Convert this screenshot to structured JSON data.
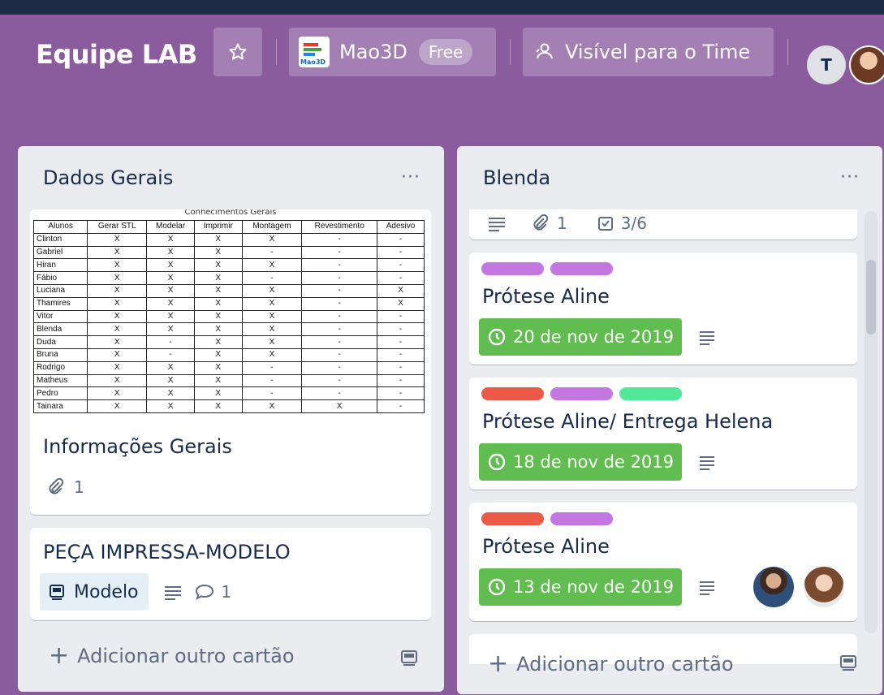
{
  "board": {
    "title": "Equipe LAB",
    "org_name": "Mao3D",
    "org_logo_text": "Mao3D",
    "org_plan": "Free",
    "visibility": "Visível para o Time",
    "member_initial": "T"
  },
  "lists": [
    {
      "title": "Dados Gerais",
      "menu": "···",
      "cards": [
        {
          "title": "Informações Gerais",
          "attachments": "1",
          "cover_table": {
            "caption": "Conhecimentos Gerais",
            "headers": [
              "Alunos",
              "Gerar STL",
              "Modelar",
              "Imprimir",
              "Montagem",
              "Revestimento",
              "Adesivo"
            ],
            "rows": [
              [
                "Clinton",
                "X",
                "X",
                "X",
                "X",
                "-",
                "-"
              ],
              [
                "Gabriel",
                "X",
                "X",
                "X",
                "-",
                "-",
                "-"
              ],
              [
                "Hiran",
                "X",
                "X",
                "X",
                "X",
                "-",
                "-"
              ],
              [
                "Fábio",
                "X",
                "X",
                "X",
                "-",
                "-",
                "-"
              ],
              [
                "Luciana",
                "X",
                "X",
                "X",
                "X",
                "-",
                "X"
              ],
              [
                "Thamires",
                "X",
                "X",
                "X",
                "X",
                "-",
                "X"
              ],
              [
                "Vitor",
                "X",
                "X",
                "X",
                "X",
                "-",
                "-"
              ],
              [
                "Blenda",
                "X",
                "X",
                "X",
                "X",
                "-",
                "-"
              ],
              [
                "Duda",
                "X",
                "-",
                "X",
                "X",
                "-",
                "-"
              ],
              [
                "Bruna",
                "X",
                "-",
                "X",
                "X",
                "-",
                "-"
              ],
              [
                "Rodrigo",
                "X",
                "X",
                "X",
                "-",
                "-",
                "-"
              ],
              [
                "Matheus",
                "X",
                "X",
                "X",
                "-",
                "-",
                "-"
              ],
              [
                "Pedro",
                "X",
                "X",
                "X",
                "-",
                "-",
                "-"
              ],
              [
                "Tainara",
                "X",
                "X",
                "X",
                "X",
                "X",
                "-"
              ]
            ]
          }
        },
        {
          "title": "PEÇA IMPRESSA-MODELO",
          "template_badge": "Modelo",
          "comments": "1"
        }
      ],
      "add_card": "Adicionar outro cartão"
    },
    {
      "title": "Blenda",
      "menu": "···",
      "cards": [
        {
          "partial": true,
          "attachments": "1",
          "checklist": "3/6"
        },
        {
          "title": "Prótese Aline",
          "due": "20 de nov de 2019",
          "labels": [
            "#c377e0",
            "#c377e0"
          ]
        },
        {
          "title": "Prótese Aline/ Entrega Helena",
          "due": "18 de nov de 2019",
          "labels": [
            "#eb5a46",
            "#c377e0",
            "#51e898"
          ]
        },
        {
          "title": "Prótese Aline",
          "due": "13 de nov de 2019",
          "labels": [
            "#eb5a46",
            "#c377e0"
          ]
        }
      ],
      "add_card": "Adicionar outro cartão"
    }
  ],
  "colors": {
    "board_bg": "#8a5c9e",
    "due_green": "#61bd4f",
    "list_bg": "#ebecf0"
  }
}
